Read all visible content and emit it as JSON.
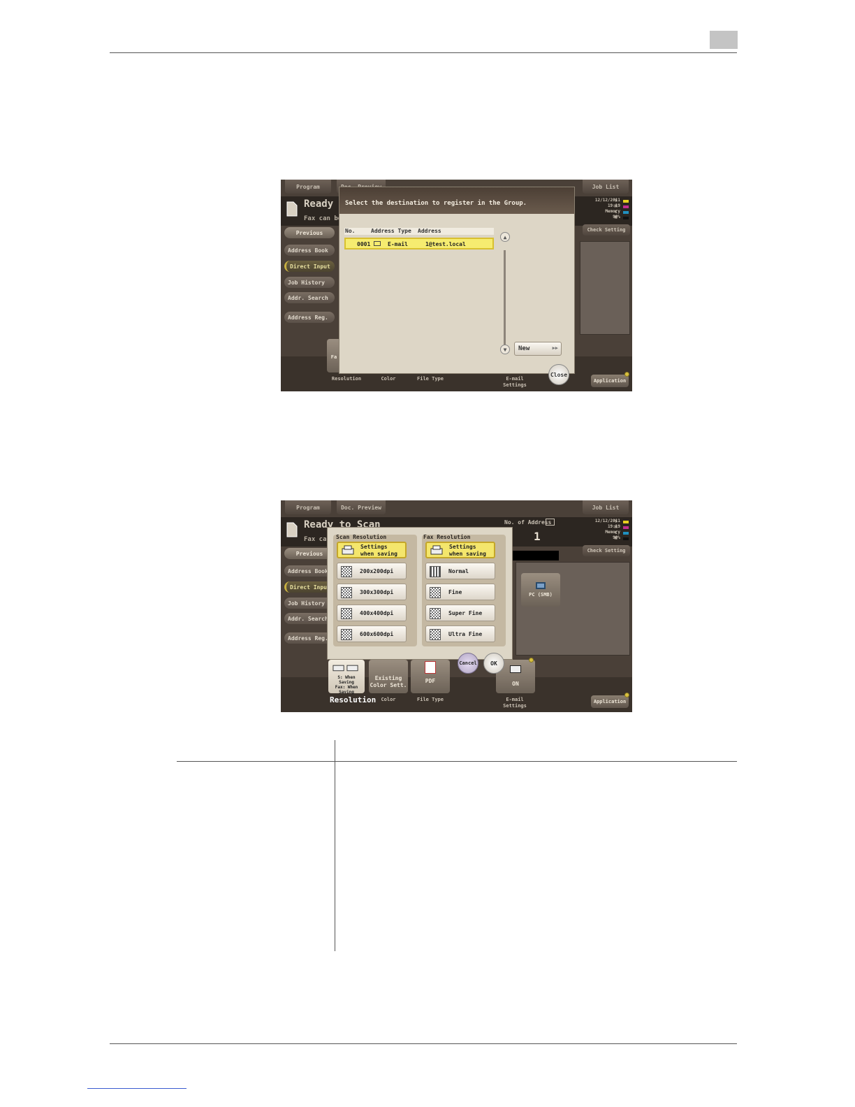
{
  "screen1": {
    "tabs": {
      "program": "Program",
      "doc_preview": "Doc. Preview",
      "job_list": "Job List"
    },
    "status": {
      "title": "Ready to",
      "subtitle": "Fax can be s"
    },
    "side_buttons": {
      "previous": "Previous",
      "address_book": "Address Book",
      "direct_input": "Direct Input",
      "job_history": "Job History",
      "addr_search": "Addr. Search",
      "address_reg": "Address Reg."
    },
    "clock": {
      "date": "12/12/2011",
      "time": "19:19",
      "memory": "Memory",
      "percent": "99%",
      "y": "Y",
      "m": "M",
      "c": "C",
      "k": "K"
    },
    "check_setting": "Check Setting",
    "dialog": {
      "title": "Select the destination to register in the Group.",
      "columns": {
        "no": "No.",
        "address_type": "Address Type",
        "address": "Address"
      },
      "row": {
        "no": "0001",
        "type": "E-mail",
        "address": "1@test.local"
      },
      "new_button": "New",
      "close_button": "Close"
    },
    "bottom": {
      "resolution": "Resolution",
      "color": "Color",
      "file_type": "File Type",
      "email_settings": "E-mail Settings",
      "application": "Application",
      "fax_fragment": "Fa"
    }
  },
  "screen2": {
    "tabs": {
      "program": "Program",
      "doc_preview": "Doc. Preview",
      "job_list": "Job List"
    },
    "status": {
      "title": "Ready to Scan",
      "subtitle": "Fax can"
    },
    "no_of_address_label": "No. of Address",
    "no_of_address_box": "",
    "no_of_address_value": "1",
    "side_buttons": {
      "previous": "Previous",
      "address_book": "Address Book",
      "direct_input": "Direct Input",
      "job_history": "Job History",
      "addr_search": "Addr. Search",
      "address_reg": "Address Reg."
    },
    "clock": {
      "date": "12/12/2011",
      "time": "19:19",
      "memory": "Memory",
      "percent": "99%",
      "y": "Y",
      "m": "M",
      "c": "C",
      "k": "K"
    },
    "check_setting": "Check Setting",
    "pc_smb": "PC (SMB)",
    "scan_resolution": {
      "title": "Scan Resolution",
      "settings_line1": "Settings",
      "settings_line2": "when saving",
      "options": [
        "200x200dpi",
        "300x300dpi",
        "400x400dpi",
        "600x600dpi"
      ]
    },
    "fax_resolution": {
      "title": "Fax Resolution",
      "settings_line1": "Settings",
      "settings_line2": "when saving",
      "options": [
        "Normal",
        "Fine",
        "Super Fine",
        "Ultra Fine"
      ]
    },
    "cancel_button": "Cancel",
    "ok_button": "OK",
    "tiles": {
      "resolution_line1": "S: When",
      "resolution_line2": "Saving",
      "resolution_line3": "Fax: When",
      "resolution_line4": "Saving",
      "color_line1": "Existing",
      "color_line2": "Color Sett.",
      "file_type": "PDF",
      "email": "ON"
    },
    "bottom": {
      "resolution": "Resolution",
      "color": "Color",
      "file_type": "File Type",
      "email_settings": "E-mail Settings",
      "application": "Application"
    }
  },
  "colors": {
    "panel_bg": "#4a4038",
    "dialog_bg": "#ddd6c6",
    "selected_yellow": "#f4e66c",
    "accent_gold": "#d8c040"
  }
}
